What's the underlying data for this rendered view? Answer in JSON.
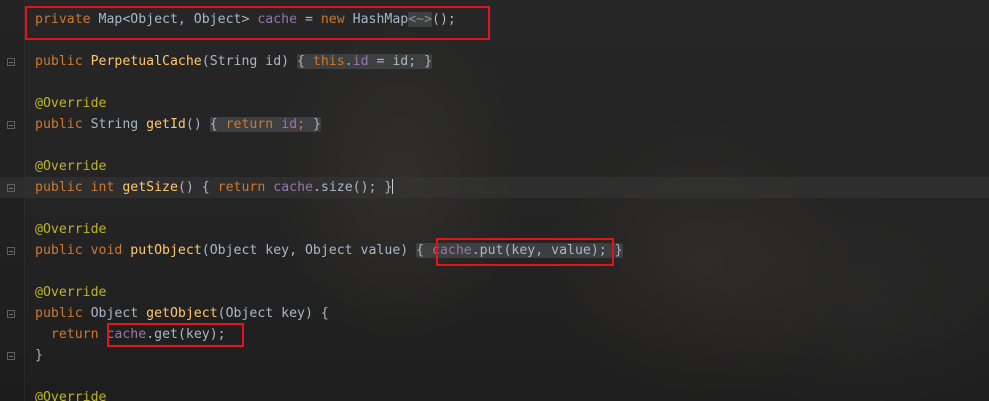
{
  "editor": {
    "lines": {
      "field": {
        "kw1": "private",
        "type": "Map<Object, Object> ",
        "name": "cache",
        "eq": " = ",
        "kw2": "new",
        "cls": " HashMap",
        "diamond": "<~>",
        "end": "();"
      },
      "ctor": {
        "kw": "public",
        "name": "PerpetualCache",
        "params": "(String id) ",
        "open": "{ ",
        "kw_this": "this",
        "dot": ".",
        "field": "id",
        "rest": " = id;",
        "close": " }"
      },
      "ann1": "@Override",
      "getid": {
        "kw": "public",
        "type": " String ",
        "name": "getId",
        "params": "() ",
        "open": "{ ",
        "kw_ret": "return",
        "sp": " ",
        "field": "id",
        "semi": ";",
        "close": " }"
      },
      "ann2": "@Override",
      "getsize": {
        "kw": "public",
        "kw_int": " int",
        "sp": " ",
        "name": "getSize",
        "params": "() ",
        "open": "{ ",
        "kw_ret": "return",
        "sp2": " ",
        "field": "cache",
        "call": ".size();",
        "close": " }"
      },
      "ann3": "@Override",
      "putobject": {
        "kw": "public",
        "kw_void": " void",
        "sp": " ",
        "name": "putObject",
        "params": "(Object key, Object value) ",
        "open": "{ ",
        "field": "cache",
        "call": ".put(key, value);",
        "close": " }"
      },
      "ann4": "@Override",
      "getobject": {
        "kw": "public",
        "type": " Object ",
        "name": "getObject",
        "params": "(Object key) {"
      },
      "ret": {
        "indent": "  ",
        "kw_ret": "return",
        "sp": " ",
        "field": "cache",
        "call": ".get(key);"
      },
      "closebrace": "}",
      "ann5": "@Override"
    },
    "highlight_color": "#e0141a"
  }
}
